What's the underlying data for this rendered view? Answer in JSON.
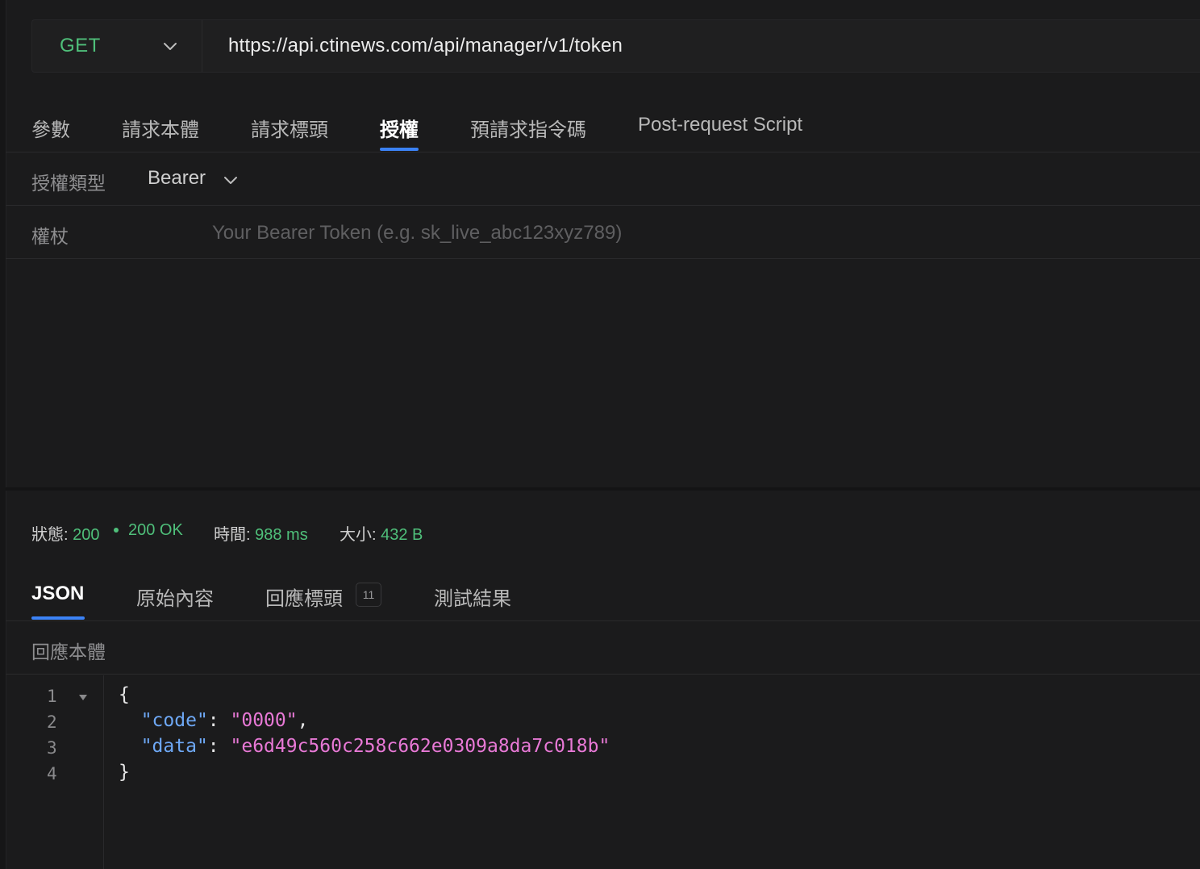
{
  "request": {
    "method": "GET",
    "url": "https://api.ctinews.com/api/manager/v1/token"
  },
  "request_tabs": [
    "參數",
    "請求本體",
    "請求標頭",
    "授權",
    "預請求指令碼",
    "Post-request Script"
  ],
  "auth": {
    "type_label": "授權類型",
    "type_value": "Bearer",
    "token_label": "權杖",
    "token_placeholder": "Your Bearer Token (e.g. sk_live_abc123xyz789)"
  },
  "response": {
    "status_label": "狀態:",
    "status_code": "200",
    "status_text": "200 OK",
    "time_label": "時間:",
    "time_value": "988 ms",
    "size_label": "大小:",
    "size_value": "432 B",
    "tabs": [
      "JSON",
      "原始內容",
      "回應標頭",
      "測試結果"
    ],
    "headers_count": "11",
    "body_label": "回應本體",
    "line_numbers": [
      "1",
      "2",
      "3",
      "4"
    ],
    "json": {
      "open": "{",
      "close": "}",
      "key1": "\"code\"",
      "val1": "\"0000\"",
      "key2": "\"data\"",
      "val2": "\"e6d49c560c258c662e0309a8da7c018b\""
    }
  },
  "colors": {
    "accent": "#3b82f6",
    "success": "#4fbf7a",
    "json_key": "#6ea8f5",
    "json_string": "#e879d6"
  },
  "icons": {
    "method_dropdown": "chevron-down-icon",
    "auth_type_dropdown": "chevron-down-icon",
    "fold": "caret-down-icon"
  }
}
